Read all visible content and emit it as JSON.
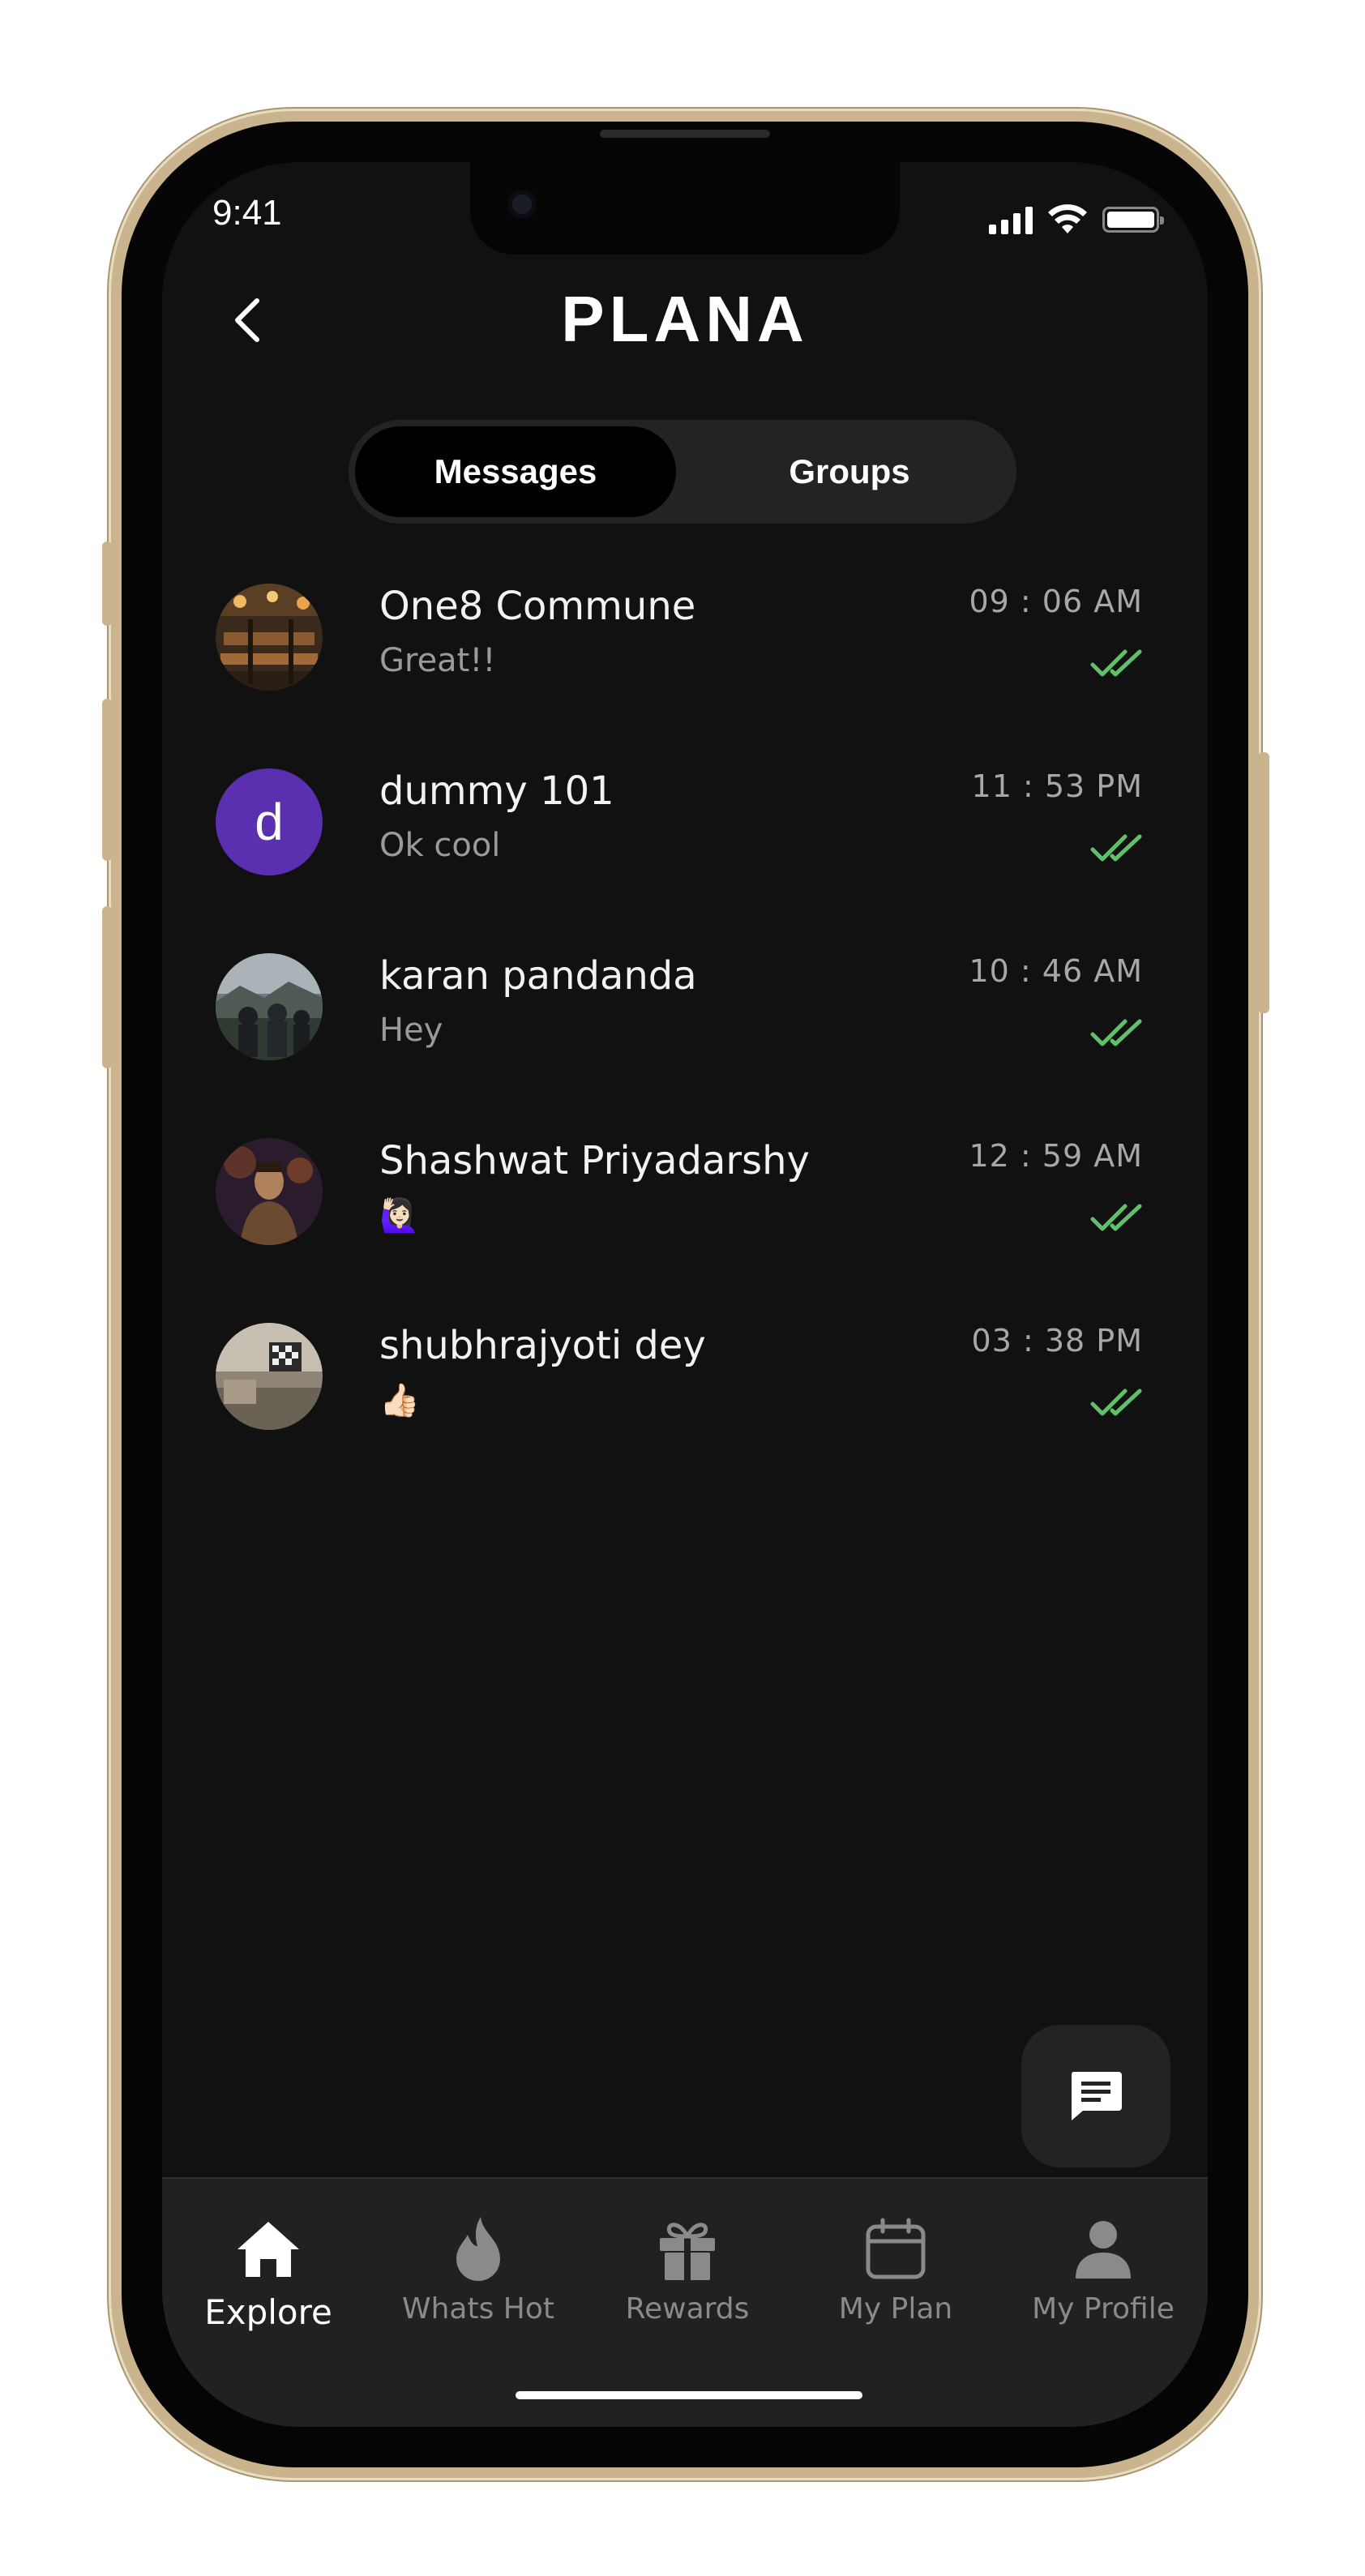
{
  "status_bar": {
    "time": "9:41"
  },
  "header": {
    "brand": "PLANA"
  },
  "segmented": {
    "messages_label": "Messages",
    "groups_label": "Groups"
  },
  "chats": [
    {
      "name": "One8 Commune",
      "preview": "Great!!",
      "time": "09 : 06 AM",
      "avatar": "photo-restaurant"
    },
    {
      "name": "dummy 101",
      "preview": "Ok cool",
      "time": "11 : 53 PM",
      "avatar_letter": "d",
      "avatar_color": "#5a2fb0"
    },
    {
      "name": "karan pandanda",
      "preview": "Hey",
      "time": "10 : 46 AM",
      "avatar": "photo-group-outdoor"
    },
    {
      "name": "Shashwat Priyadarshy",
      "preview": "🙋🏻‍♀️",
      "time": "12 : 59 AM",
      "avatar": "photo-portrait"
    },
    {
      "name": "shubhrajyoti dey",
      "preview": "👍🏻",
      "time": "03 : 38 PM",
      "avatar": "photo-room"
    }
  ],
  "read_tick_color": "#5fbf6a",
  "tabs": [
    {
      "label": "Explore",
      "icon": "home-icon",
      "active": true
    },
    {
      "label": "Whats Hot",
      "icon": "flame-icon",
      "active": false
    },
    {
      "label": "Rewards",
      "icon": "gift-icon",
      "active": false
    },
    {
      "label": "My Plan",
      "icon": "calendar-icon",
      "active": false
    },
    {
      "label": "My Profile",
      "icon": "person-icon",
      "active": false
    }
  ]
}
